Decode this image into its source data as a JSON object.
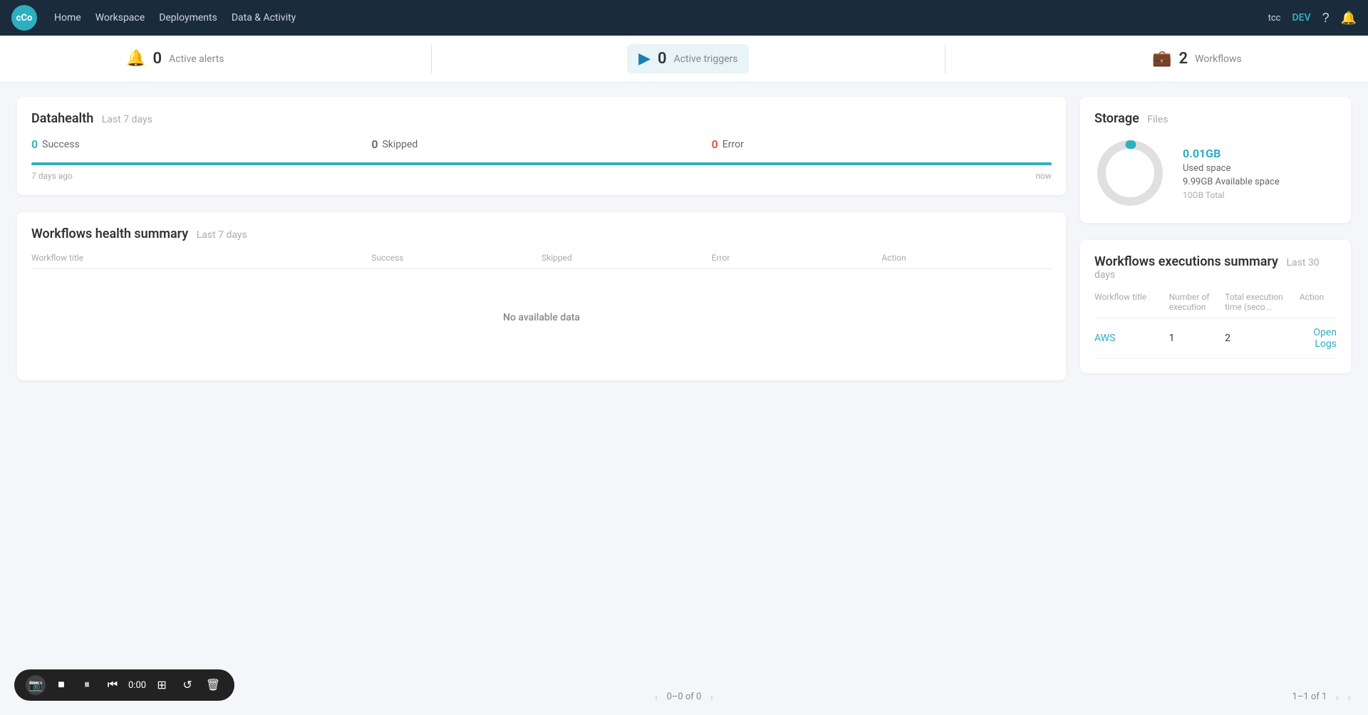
{
  "app": {
    "logo_text": "cCo",
    "user": "tcc",
    "env": "DEV"
  },
  "nav": {
    "items": [
      {
        "label": "Home",
        "id": "home"
      },
      {
        "label": "Workspace",
        "id": "workspace"
      },
      {
        "label": "Deployments",
        "id": "deployments"
      },
      {
        "label": "Data & Activity",
        "id": "data-activity"
      }
    ]
  },
  "summary": {
    "alerts": {
      "count": "0",
      "label": "Active alerts"
    },
    "triggers": {
      "count": "0",
      "label": "Active triggers"
    },
    "workflows": {
      "count": "2",
      "label": "Workflows"
    }
  },
  "datahealth": {
    "title": "Datahealth",
    "subtitle": "Last 7 days",
    "success_count": "0",
    "success_label": "Success",
    "skipped_count": "0",
    "skipped_label": "Skipped",
    "error_count": "0",
    "error_label": "Error",
    "bar_start": "7 days ago",
    "bar_end": "now"
  },
  "workflows_health": {
    "title": "Workflows health summary",
    "subtitle": "Last 7 days",
    "columns": [
      "Workflow title",
      "Success",
      "Skipped",
      "Error",
      "Action"
    ],
    "no_data": "No available data"
  },
  "storage": {
    "title": "Storage",
    "subtitle": "Files",
    "used_space": "0.01GB",
    "used_label": "Used space",
    "available_space": "9.99GB",
    "available_label": "Available space",
    "total": "10GB Total",
    "donut_used_pct": 0.1,
    "donut_color_used": "#2eafc0",
    "donut_color_available": "#e0e0e0"
  },
  "workflows_executions": {
    "title": "Workflows executions summary",
    "subtitle": "Last 30 days",
    "columns": [
      "Workflow title",
      "Number of execution",
      "Total execution time (seco...",
      "Action"
    ],
    "rows": [
      {
        "title": "AWS",
        "executions": "1",
        "total_time": "2",
        "action": "Open Logs"
      }
    ]
  },
  "recording": {
    "timer": "0:00",
    "pagination_center": "0–0 of 0",
    "pagination_right": "1–1 of 1"
  }
}
